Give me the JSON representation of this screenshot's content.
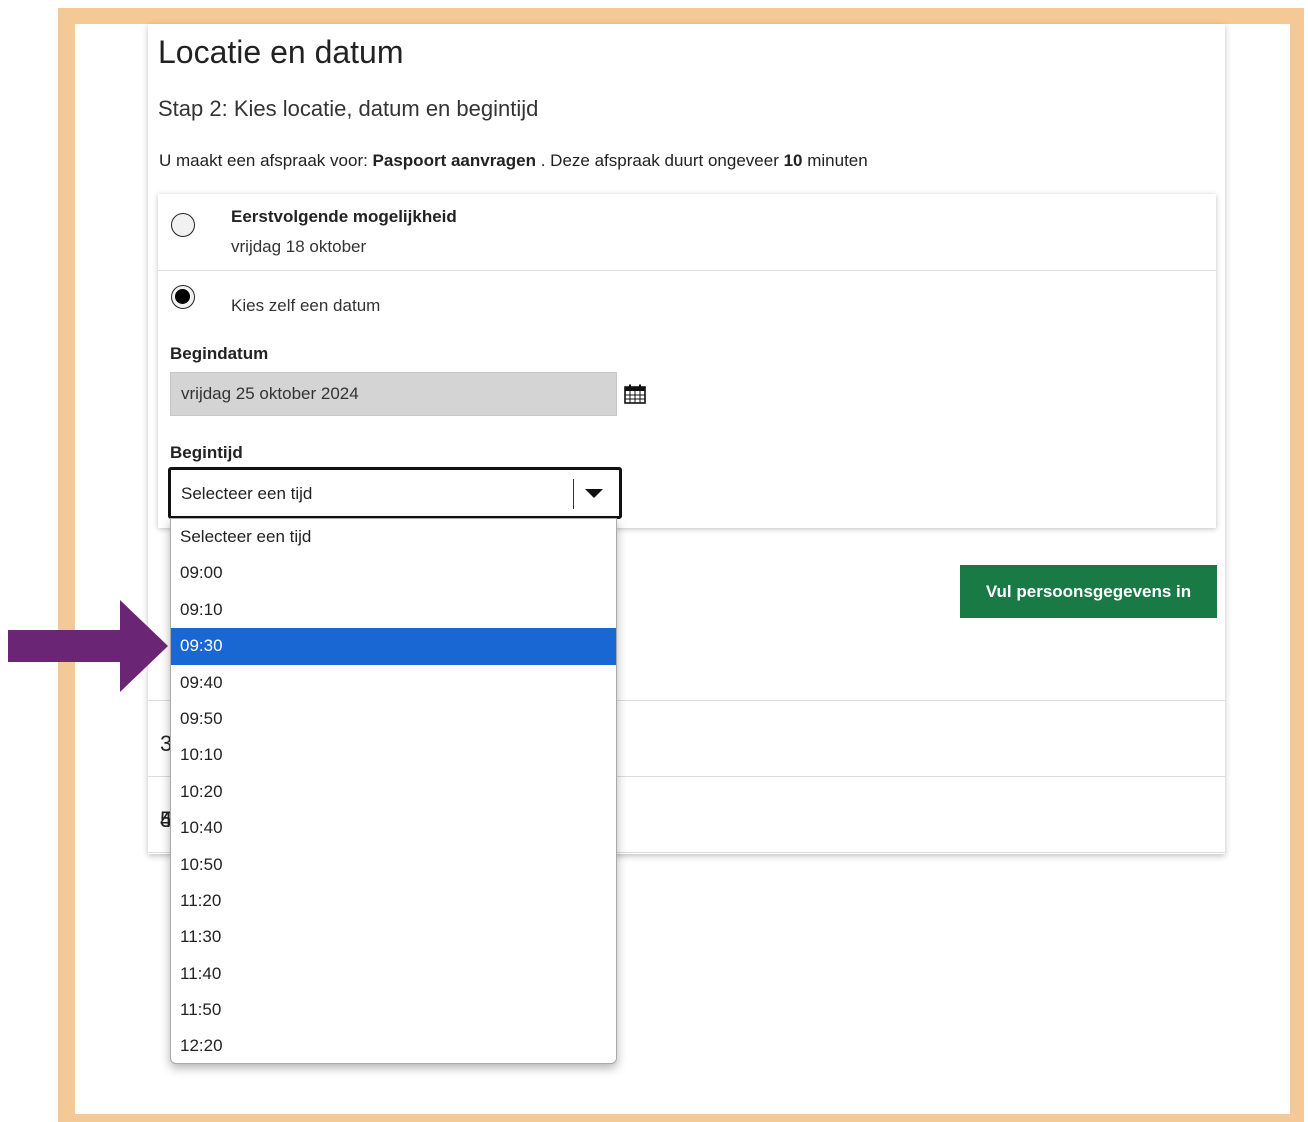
{
  "page": {
    "title": "Locatie en datum",
    "subtitle": "Stap 2: Kies locatie, datum en begintijd",
    "info_prefix": "U maakt een afspraak voor: ",
    "info_service": "Paspoort aanvragen",
    "info_middle": " . Deze afspraak duurt ongeveer ",
    "info_duration": "10",
    "info_suffix": " minuten"
  },
  "options": {
    "first": {
      "title": "Eerstvolgende mogelijkheid",
      "date": "vrijdag 18 oktober",
      "checked": false
    },
    "own": {
      "label": "Kies zelf een datum",
      "checked": true
    }
  },
  "form": {
    "start_date_label": "Begindatum",
    "start_date_value": "vrijdag 25 oktober 2024",
    "start_time_label": "Begintijd",
    "start_time_value": "Selecteer een tijd"
  },
  "next_button": "Vul persoonsgegevens in",
  "steps_behind": [
    "3",
    "4",
    "5"
  ],
  "dropdown": {
    "items": [
      "Selecteer een tijd",
      "09:00",
      "09:10",
      "09:30",
      "09:40",
      "09:50",
      "10:10",
      "10:20",
      "10:40",
      "10:50",
      "11:20",
      "11:30",
      "11:40",
      "11:50",
      "12:20"
    ],
    "highlighted": "09:30"
  },
  "colors": {
    "frame": "#f5c996",
    "button": "#1a7a46",
    "highlight": "#1967d2",
    "arrow": "#6b2575"
  },
  "icons": {
    "calendar": "calendar-icon",
    "arrow": "pointer-arrow-icon"
  }
}
